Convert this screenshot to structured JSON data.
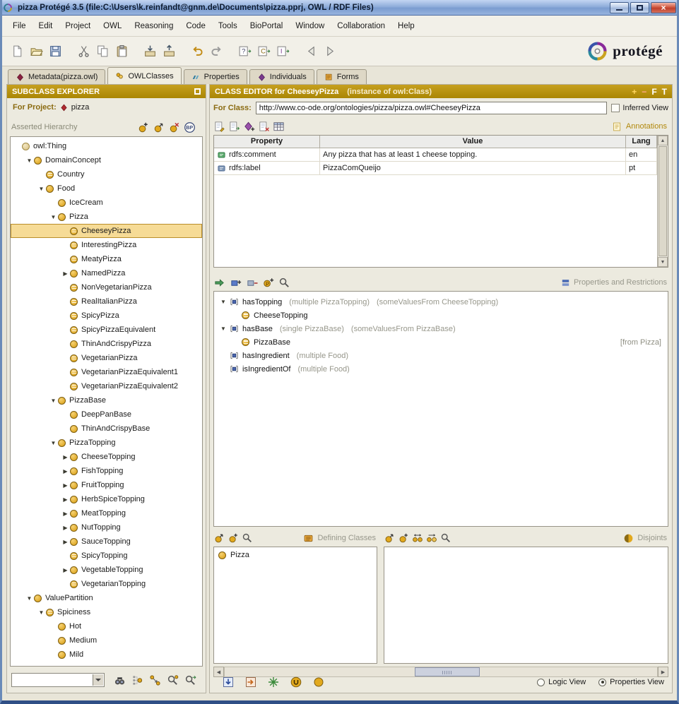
{
  "titlebar": {
    "title": "pizza  Protégé 3.5    (file:C:\\Users\\k.reinfandt@gnm.de\\Documents\\pizza.pprj, OWL / RDF Files)"
  },
  "menubar": {
    "items": [
      "File",
      "Edit",
      "Project",
      "OWL",
      "Reasoning",
      "Code",
      "Tools",
      "BioPortal",
      "Window",
      "Collaboration",
      "Help"
    ]
  },
  "toolbar": {
    "icons": [
      "new-project-icon",
      "open-project-icon",
      "save-project-icon",
      "sep",
      "cut-icon",
      "copy-icon",
      "paste-icon",
      "sep",
      "archive-project-icon",
      "extract-archive-icon",
      "sep",
      "undo-icon",
      "redo-icon",
      "sep",
      "query-dialog-icon",
      "class-dialog-icon",
      "individual-dialog-icon",
      "sep",
      "back-icon",
      "forward-icon"
    ]
  },
  "logo": {
    "text": "protégé"
  },
  "tabs": [
    {
      "label": "Metadata(pizza.owl)",
      "icon": "metadata-icon",
      "active": false
    },
    {
      "label": "OWLClasses",
      "icon": "owlclasses-icon",
      "active": true
    },
    {
      "label": "Properties",
      "icon": "properties-icon",
      "active": false
    },
    {
      "label": "Individuals",
      "icon": "individuals-icon",
      "active": false
    },
    {
      "label": "Forms",
      "icon": "forms-icon",
      "active": false
    }
  ],
  "explorer": {
    "header": "SUBCLASS EXPLORER",
    "for_project_label": "For Project:",
    "project": "pizza",
    "hierarchy_label": "Asserted Hierarchy",
    "toolbar": [
      "create-class-icon",
      "create-subclass-icon",
      "delete-class-icon",
      "bioportal-icon"
    ],
    "bottom_icons": [
      "find-class-icon",
      "superclass-view-icon",
      "class-relations-icon",
      "find-class-dialog-icon",
      "goto-definition-icon"
    ],
    "tree": [
      {
        "label": "owl:Thing",
        "depth": 0,
        "icon": "thing",
        "arrow": ""
      },
      {
        "label": "DomainConcept",
        "depth": 1,
        "icon": "class",
        "arrow": "open"
      },
      {
        "label": "Country",
        "depth": 2,
        "icon": "def",
        "arrow": ""
      },
      {
        "label": "Food",
        "depth": 2,
        "icon": "class",
        "arrow": "open"
      },
      {
        "label": "IceCream",
        "depth": 3,
        "icon": "class",
        "arrow": ""
      },
      {
        "label": "Pizza",
        "depth": 3,
        "icon": "class",
        "arrow": "open"
      },
      {
        "label": "CheeseyPizza",
        "depth": 4,
        "icon": "def",
        "arrow": "",
        "selected": true
      },
      {
        "label": "InterestingPizza",
        "depth": 4,
        "icon": "def",
        "arrow": ""
      },
      {
        "label": "MeatyPizza",
        "depth": 4,
        "icon": "def",
        "arrow": ""
      },
      {
        "label": "NamedPizza",
        "depth": 4,
        "icon": "class",
        "arrow": "closed"
      },
      {
        "label": "NonVegetarianPizza",
        "depth": 4,
        "icon": "def",
        "arrow": ""
      },
      {
        "label": "RealItalianPizza",
        "depth": 4,
        "icon": "def",
        "arrow": ""
      },
      {
        "label": "SpicyPizza",
        "depth": 4,
        "icon": "def",
        "arrow": ""
      },
      {
        "label": "SpicyPizzaEquivalent",
        "depth": 4,
        "icon": "def",
        "arrow": ""
      },
      {
        "label": "ThinAndCrispyPizza",
        "depth": 4,
        "icon": "class",
        "arrow": ""
      },
      {
        "label": "VegetarianPizza",
        "depth": 4,
        "icon": "def",
        "arrow": ""
      },
      {
        "label": "VegetarianPizzaEquivalent1",
        "depth": 4,
        "icon": "def",
        "arrow": ""
      },
      {
        "label": "VegetarianPizzaEquivalent2",
        "depth": 4,
        "icon": "def",
        "arrow": ""
      },
      {
        "label": "PizzaBase",
        "depth": 3,
        "icon": "class",
        "arrow": "open"
      },
      {
        "label": "DeepPanBase",
        "depth": 4,
        "icon": "class",
        "arrow": ""
      },
      {
        "label": "ThinAndCrispyBase",
        "depth": 4,
        "icon": "class",
        "arrow": ""
      },
      {
        "label": "PizzaTopping",
        "depth": 3,
        "icon": "class",
        "arrow": "open"
      },
      {
        "label": "CheeseTopping",
        "depth": 4,
        "icon": "class",
        "arrow": "closed"
      },
      {
        "label": "FishTopping",
        "depth": 4,
        "icon": "class",
        "arrow": "closed"
      },
      {
        "label": "FruitTopping",
        "depth": 4,
        "icon": "class",
        "arrow": "closed"
      },
      {
        "label": "HerbSpiceTopping",
        "depth": 4,
        "icon": "class",
        "arrow": "closed"
      },
      {
        "label": "MeatTopping",
        "depth": 4,
        "icon": "class",
        "arrow": "closed"
      },
      {
        "label": "NutTopping",
        "depth": 4,
        "icon": "class",
        "arrow": "closed"
      },
      {
        "label": "SauceTopping",
        "depth": 4,
        "icon": "class",
        "arrow": "closed"
      },
      {
        "label": "SpicyTopping",
        "depth": 4,
        "icon": "def",
        "arrow": ""
      },
      {
        "label": "VegetableTopping",
        "depth": 4,
        "icon": "class",
        "arrow": "closed"
      },
      {
        "label": "VegetarianTopping",
        "depth": 4,
        "icon": "def",
        "arrow": ""
      },
      {
        "label": "ValuePartition",
        "depth": 1,
        "icon": "class",
        "arrow": "open"
      },
      {
        "label": "Spiciness",
        "depth": 2,
        "icon": "def",
        "arrow": "open"
      },
      {
        "label": "Hot",
        "depth": 3,
        "icon": "class",
        "arrow": ""
      },
      {
        "label": "Medium",
        "depth": 3,
        "icon": "class",
        "arrow": ""
      },
      {
        "label": "Mild",
        "depth": 3,
        "icon": "class",
        "arrow": ""
      }
    ]
  },
  "editor": {
    "header_title": "CLASS EDITOR for CheeseyPizza",
    "header_sub": "(instance of owl:Class)",
    "header_icons": [
      "add-widget-icon",
      "remove-widget-icon",
      "form-widget-icon",
      "text-widget-icon"
    ],
    "for_class_label": "For Class:",
    "class_uri": "http://www.co-ode.org/ontologies/pizza/pizza.owl#CheeseyPizza",
    "inferred_view_label": "Inferred View",
    "annotations": {
      "label": "Annotations",
      "toolbar": [
        "add-annotation-icon",
        "add-annotation-dialog-icon",
        "add-resource-annotation-icon",
        "delete-annotation-icon",
        "annotation-table-icon"
      ],
      "columns": [
        "Property",
        "Value",
        "Lang"
      ],
      "rows": [
        {
          "property": "rdfs:comment",
          "value": "Any pizza that has at least 1 cheese topping.",
          "lang": "en",
          "icon": "comment-icon"
        },
        {
          "property": "rdfs:label",
          "value": "PizzaComQueijo",
          "lang": "pt",
          "icon": "label-icon"
        }
      ]
    },
    "restrictions": {
      "label": "Properties and Restrictions",
      "toolbar": [
        "add-restriction-icon",
        "add-class-expression-icon",
        "remove-condition-icon",
        "add-property-icon",
        "view-condition-icon"
      ],
      "rows": [
        {
          "kind": "property",
          "arrow": "open",
          "name": "hasTopping",
          "cardinality": "(multiple PizzaTopping)",
          "restriction": "(someValuesFrom CheeseTopping)"
        },
        {
          "kind": "class",
          "name": "CheeseTopping"
        },
        {
          "kind": "property",
          "arrow": "open",
          "name": "hasBase",
          "cardinality": "(single PizzaBase)",
          "restriction": "(someValuesFrom PizzaBase)"
        },
        {
          "kind": "class",
          "name": "PizzaBase",
          "note": "[from Pizza]"
        },
        {
          "kind": "property",
          "name": "hasIngredient",
          "cardinality": "(multiple Food)"
        },
        {
          "kind": "property",
          "name": "isIngredientOf",
          "cardinality": "(multiple Food)"
        }
      ]
    },
    "defining_classes": {
      "label": "Defining Classes",
      "toolbar": [
        "add-class-dialog-icon",
        "add-class-icon",
        "view-class-icon"
      ],
      "items": [
        "Pizza"
      ]
    },
    "disjoints": {
      "label": "Disjoints",
      "toolbar": [
        "add-disjoint-dialog-icon",
        "add-disjoint-icon",
        "add-all-disjoints-icon",
        "add-sibling-disjoints-icon",
        "view-disjoint-icon"
      ],
      "items": []
    },
    "bottom_icons": [
      "import-conditions-icon",
      "export-conditions-icon",
      "reasoner-icon",
      "union-class-icon",
      "class-dot-icon"
    ],
    "view_toggle": {
      "logic": "Logic View",
      "properties": "Properties View",
      "selected": "properties"
    }
  }
}
